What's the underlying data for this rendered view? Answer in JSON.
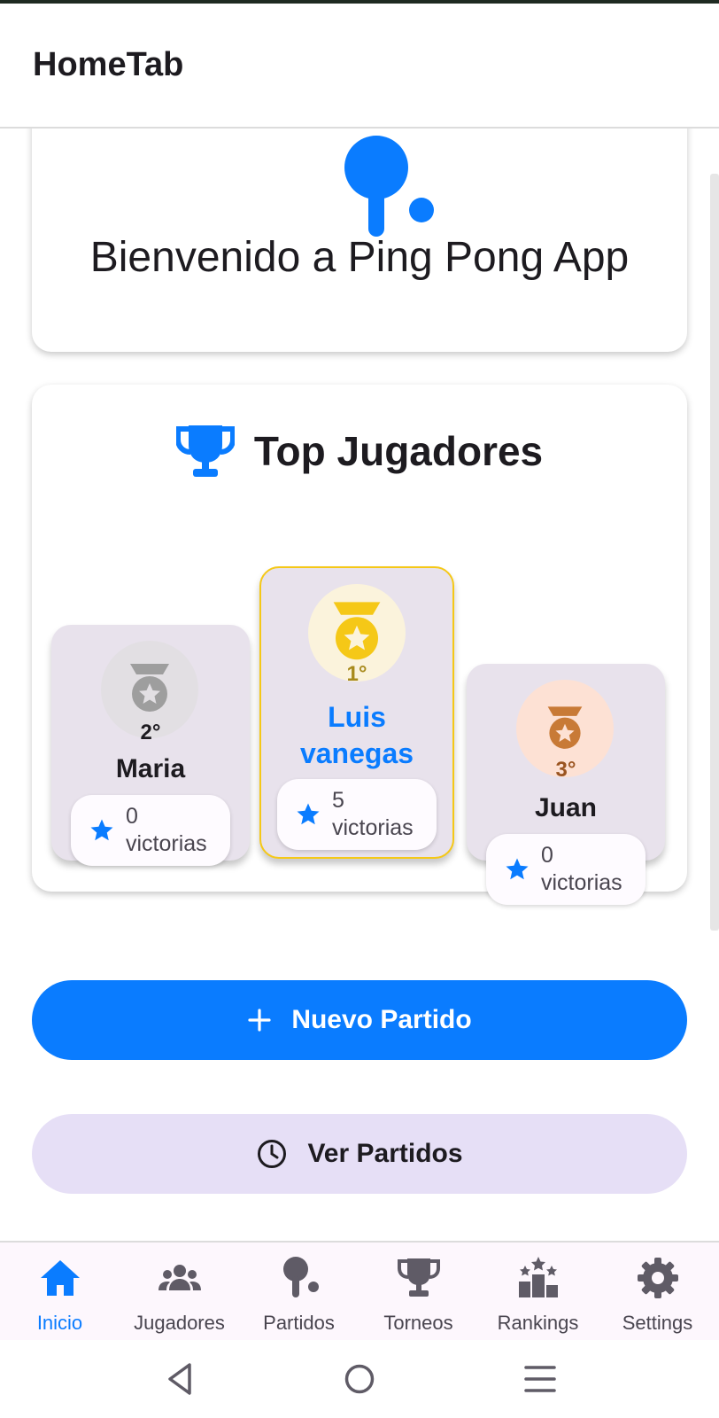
{
  "app_bar": {
    "title": "HomeTab"
  },
  "welcome": {
    "text": "Bienvenido a Ping Pong App"
  },
  "top_players": {
    "title": "Top Jugadores",
    "second": {
      "rank": "2°",
      "name": "Maria",
      "wins_count": "0",
      "wins_label": "victorias"
    },
    "first": {
      "rank": "1°",
      "name": "Luis vanegas",
      "wins_count": "5",
      "wins_label": "victorias"
    },
    "third": {
      "rank": "3°",
      "name": "Juan",
      "wins_count": "0",
      "wins_label": "victorias"
    }
  },
  "buttons": {
    "new_match": "Nuevo Partido",
    "view_matches": "Ver Partidos"
  },
  "bottom_nav": {
    "items": [
      {
        "label": "Inicio",
        "icon": "home-icon",
        "active": true
      },
      {
        "label": "Jugadores",
        "icon": "group-icon"
      },
      {
        "label": "Partidos",
        "icon": "ping-pong-icon"
      },
      {
        "label": "Torneos",
        "icon": "trophy-icon"
      },
      {
        "label": "Rankings",
        "icon": "rankings-icon"
      },
      {
        "label": "Settings",
        "icon": "gear-icon"
      }
    ]
  },
  "colors": {
    "primary": "#0a7cff",
    "gold": "#f5c817",
    "silver": "#9e9e9e",
    "bronze": "#c87a36",
    "podium_bg": "#e8e2ec",
    "secondary_button": "#e6dff6"
  }
}
